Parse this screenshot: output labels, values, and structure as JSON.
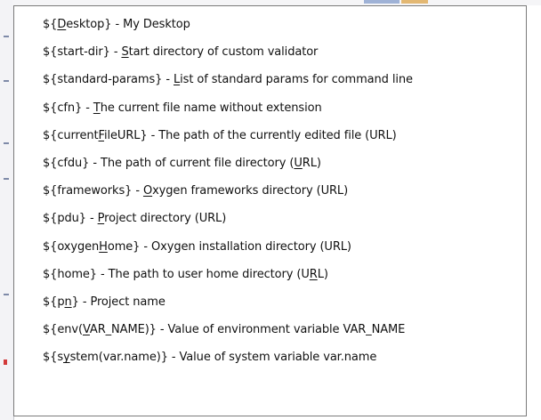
{
  "items": [
    {
      "pre": "${",
      "mn": "D",
      "post": "esktop} - My Desktop"
    },
    {
      "pre": "${start-dir} - ",
      "mn": "S",
      "post": "tart directory of custom validator"
    },
    {
      "pre": "${standard-params} - ",
      "mn": "L",
      "post": "ist of standard params for command line"
    },
    {
      "pre": "${cfn} - ",
      "mn": "T",
      "post": "he current file name without extension"
    },
    {
      "pre": "${current",
      "mn": "F",
      "post": "ileURL} - The path of the currently edited file (URL)"
    },
    {
      "pre": "${cfdu} - The path of current file directory (",
      "mn": "U",
      "post": "RL)"
    },
    {
      "pre": "${frameworks} - ",
      "mn": "O",
      "post": "xygen frameworks directory (URL)"
    },
    {
      "pre": "${pdu} - ",
      "mn": "P",
      "post": "roject directory (URL)"
    },
    {
      "pre": "${oxygen",
      "mn": "H",
      "post": "ome} - Oxygen installation directory (URL)"
    },
    {
      "pre": "${home} - The path to user home directory (U",
      "mn": "R",
      "post": "L)"
    },
    {
      "pre": "${p",
      "mn": "n",
      "post": "} - Project name"
    },
    {
      "pre": "${env(",
      "mn": "V",
      "post": "AR_NAME)} - Value of environment variable VAR_NAME"
    },
    {
      "pre": "${s",
      "mn": "y",
      "post": "stem(var.name)} - Value of system variable var.name"
    }
  ]
}
